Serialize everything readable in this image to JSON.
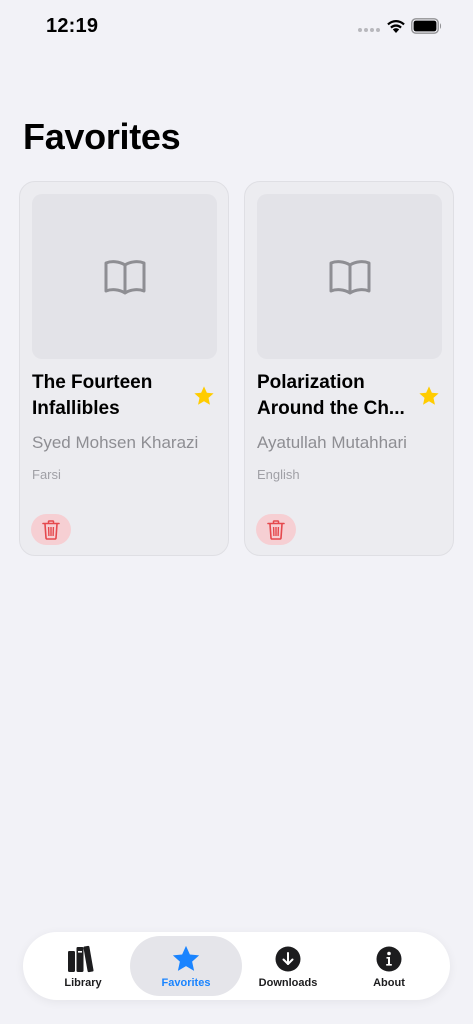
{
  "status_bar": {
    "time": "12:19"
  },
  "page": {
    "title": "Favorites"
  },
  "favorites": [
    {
      "title": "The Fourteen Infallibles",
      "author": "Syed Mohsen Kharazi",
      "language": "Farsi",
      "favorited": true
    },
    {
      "title": "Polarization Around the Ch...",
      "author": "Ayatullah Mutahhari",
      "language": "English",
      "favorited": true
    }
  ],
  "tab_bar": {
    "tabs": [
      {
        "label": "Library",
        "icon": "books-icon",
        "active": false
      },
      {
        "label": "Favorites",
        "icon": "star-icon",
        "active": true
      },
      {
        "label": "Downloads",
        "icon": "download-icon",
        "active": false
      },
      {
        "label": "About",
        "icon": "info-icon",
        "active": false
      }
    ]
  },
  "colors": {
    "background": "#f2f2f7",
    "accent": "#1a84ff",
    "star": "#ffcc00",
    "delete": "#e5484d"
  }
}
